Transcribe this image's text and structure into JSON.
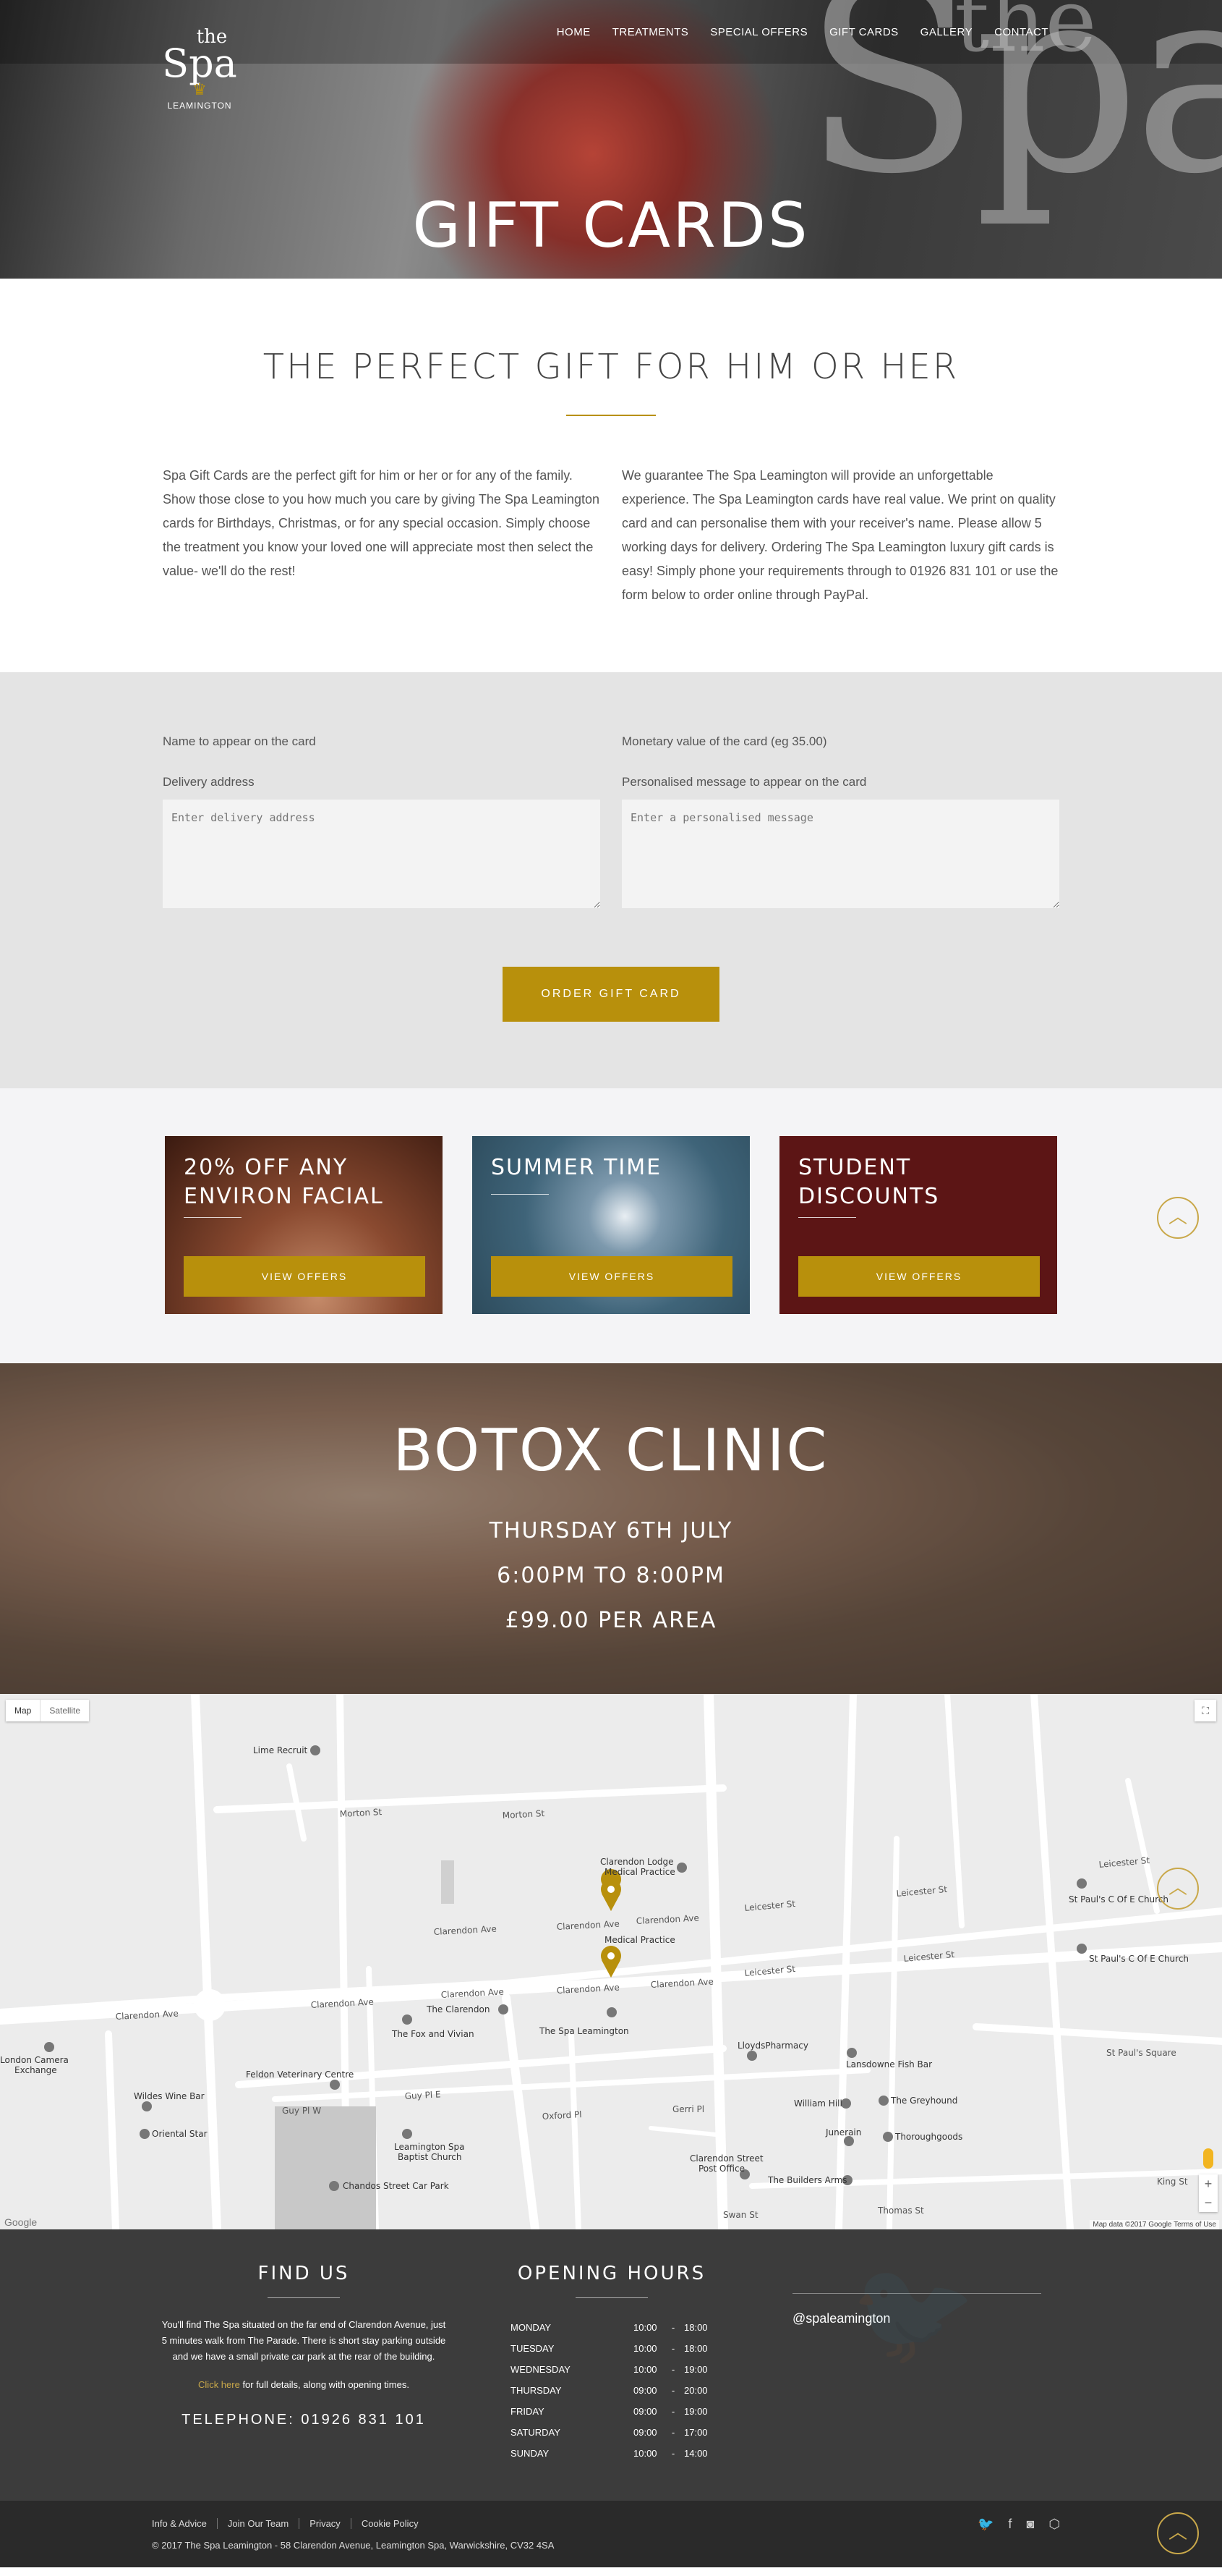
{
  "brand": {
    "the": "the",
    "spa": "Spa",
    "location": "LEAMINGTON",
    "crown": "♛"
  },
  "nav": [
    "HOME",
    "TREATMENTS",
    "SPECIAL OFFERS",
    "GIFT CARDS",
    "GALLERY",
    "CONTACT"
  ],
  "hero": {
    "title": "GIFT CARDS"
  },
  "intro": {
    "heading": "THE PERFECT GIFT FOR HIM OR HER",
    "left": "Spa Gift Cards are the perfect gift for him or her or for any of the family. Show those close to you how much you care by giving The Spa Leamington cards for Birthdays, Christmas, or for any special occasion. Simply choose the treatment you know your loved one will appreciate most then select the value- we'll do the rest!",
    "right": "We guarantee The Spa Leamington will provide an unforgettable experience. The Spa Leamington cards have real value. We print on quality card and can personalise them with your receiver's name. Please allow 5 working days for delivery. Ordering The Spa Leamington luxury gift cards is easy! Simply phone your requirements through to 01926 831 101 or use the form below to order online through PayPal."
  },
  "form": {
    "name_label": "Name to appear on the card",
    "value_label": "Monetary value of the card (eg 35.00)",
    "address_label": "Delivery address",
    "address_placeholder": "Enter delivery address",
    "message_label": "Personalised message to appear on the card",
    "message_placeholder": "Enter a personalised message",
    "order_button": "ORDER GIFT CARD"
  },
  "offers": [
    {
      "title": "20% OFF ANY ENVIRON FACIAL",
      "button": "VIEW OFFERS"
    },
    {
      "title": "SUMMER TIME",
      "button": "VIEW OFFERS"
    },
    {
      "title": "STUDENT DISCOUNTS",
      "button": "VIEW OFFERS"
    }
  ],
  "botox": {
    "title": "BOTOX CLINIC",
    "date": "THURSDAY 6TH JULY",
    "time": "6:00PM TO 8:00PM",
    "price": "£99.00 PER AREA"
  },
  "map": {
    "map_tab": "Map",
    "satellite_tab": "Satellite",
    "credit": "Map data ©2017 Google   Terms of Use",
    "google": "Google",
    "streets": [
      "Morton St",
      "Clarendon Ave",
      "Leicester St",
      "Guy Pl E",
      "Oxford Pl",
      "Gerri Pl",
      "Swan St",
      "Thomas St",
      "King St",
      "St Paul's Square"
    ],
    "places": [
      "Lime Recruit",
      "Clarendon Lodge Medical Practice",
      "Medical Practice",
      "The Clarendon",
      "The Fox and Vivian",
      "The Spa Leamington",
      "Feldon Veterinary Centre",
      "Wildes Wine Bar",
      "Oriental Star",
      "Leamington Spa Baptist Church",
      "Chandos Street Car Park",
      "LloydsPharmacy",
      "Lansdowne Fish Bar",
      "William Hill",
      "The Greyhound",
      "Junerain",
      "Thoroughgoods",
      "Clarendon Street Post Office",
      "The Builders Arms",
      "St Paul's C Of E Church",
      "London Camera Exchange"
    ]
  },
  "footer": {
    "find_us": {
      "heading": "FIND US",
      "text": "You'll find The Spa situated on the far end of Clarendon Avenue, just 5 minutes walk from The Parade. There is short stay parking outside and we have a small private car park at the rear of the building.",
      "click_link": "Click here",
      "click_rest": " for full details, along with opening times.",
      "phone": "TELEPHONE: 01926 831 101"
    },
    "hours": {
      "heading": "OPENING HOURS",
      "rows": [
        {
          "day": "MONDAY",
          "open": "10:00",
          "close": "18:00"
        },
        {
          "day": "TUESDAY",
          "open": "10:00",
          "close": "18:00"
        },
        {
          "day": "WEDNESDAY",
          "open": "10:00",
          "close": "19:00"
        },
        {
          "day": "THURSDAY",
          "open": "09:00",
          "close": "20:00"
        },
        {
          "day": "FRIDAY",
          "open": "09:00",
          "close": "19:00"
        },
        {
          "day": "SATURDAY",
          "open": "09:00",
          "close": "17:00"
        },
        {
          "day": "SUNDAY",
          "open": "10:00",
          "close": "14:00"
        }
      ]
    },
    "twitter_handle": "@spaleamington",
    "links": [
      "Info & Advice",
      "Join Our Team",
      "Privacy",
      "Cookie Policy"
    ],
    "copyright": "© 2017 The Spa Leamington - 58 Clarendon Avenue, Leamington Spa, Warwickshire, CV32 4SA"
  },
  "colors": {
    "gold": "#b8900c",
    "footer": "#3c3c3c",
    "form_bg": "#e4e4e4"
  }
}
